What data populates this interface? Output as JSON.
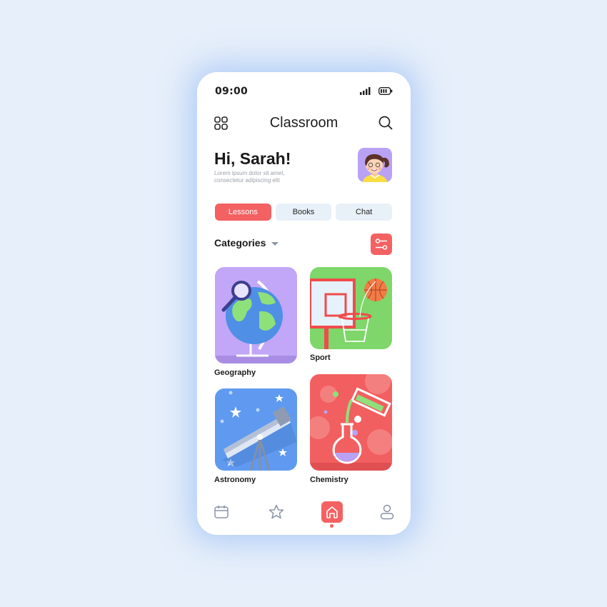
{
  "status_bar": {
    "time": "09:00",
    "signal_icon": "signal-bars-icon",
    "battery_icon": "battery-icon"
  },
  "header": {
    "title": "Classroom",
    "menu_icon": "grid-menu-icon",
    "search_icon": "search-icon"
  },
  "greeting": {
    "title": "Hi, Sarah!",
    "subtitle_line1": "Lorem ipsum dolor sit amet,",
    "subtitle_line2": "consectetur adipiscing elit"
  },
  "tabs": [
    {
      "label": "Lessons",
      "active": true
    },
    {
      "label": "Books",
      "active": false
    },
    {
      "label": "Chat",
      "active": false
    }
  ],
  "categories": {
    "header": "Categories",
    "items": [
      {
        "label": "Geography",
        "color": "#c2a6f7"
      },
      {
        "label": "Sport",
        "color": "#7fd66a"
      },
      {
        "label": "Astronomy",
        "color": "#5f9af0"
      },
      {
        "label": "Chemistry",
        "color": "#f25f60"
      }
    ]
  },
  "bottom_nav": [
    {
      "icon": "calendar-icon",
      "active": false
    },
    {
      "icon": "star-icon",
      "active": false
    },
    {
      "icon": "home-icon",
      "active": true
    },
    {
      "icon": "profile-icon",
      "active": false
    }
  ],
  "colors": {
    "accent": "#f46163",
    "background": "#e6effa",
    "tab_inactive": "#e8f1f8"
  }
}
